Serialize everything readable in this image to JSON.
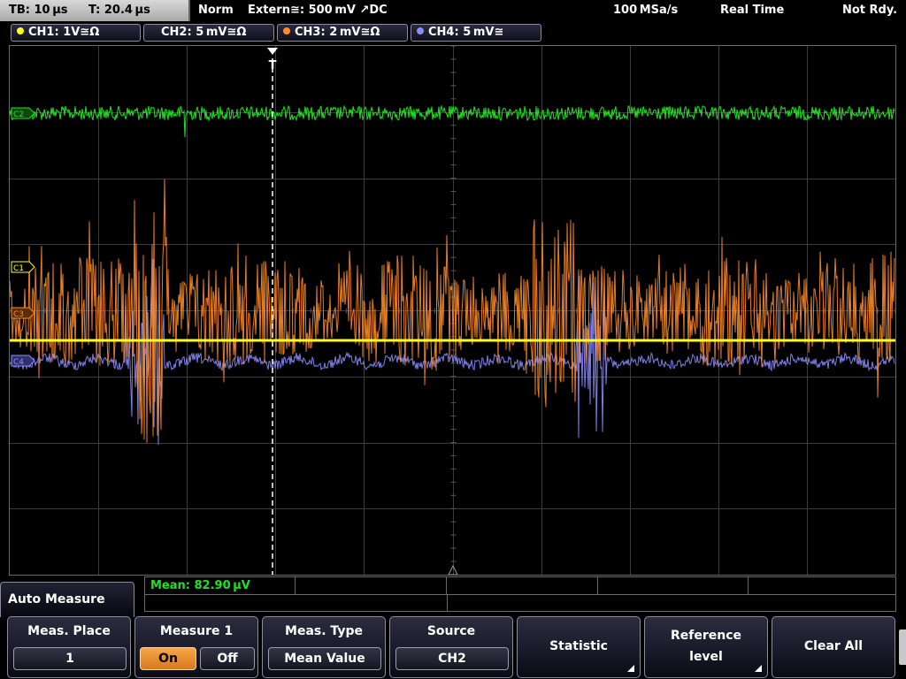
{
  "status_bar": {
    "timebase": "TB: 10 µs",
    "trigger_time": "T: 20.4 µs",
    "mode": "Norm",
    "trigger": "Extern≅: 500 mV ↗DC",
    "sample_rate": "100 MSa/s",
    "acq_mode": "Real Time",
    "state": "Not Rdy."
  },
  "channels": [
    {
      "label": "CH1: 1V≅Ω",
      "color": "#ffff20",
      "active": false
    },
    {
      "label": "CH2: 5 mV≅Ω",
      "color": "#22e022",
      "active": true
    },
    {
      "label": "CH3: 2 mV≅Ω",
      "color": "#ff8c28",
      "active": false
    },
    {
      "label": "CH4: 5 mV≅",
      "color": "#8c8cff",
      "active": false
    }
  ],
  "markers": {
    "ch1": "C1",
    "ch2": "C2",
    "ch3": "C3",
    "ch4": "C4",
    "trigger": "T"
  },
  "measurement": {
    "result": "Mean: 82.90 µV",
    "result_color": "#22e022"
  },
  "menu": {
    "title": "Auto Measure"
  },
  "softkeys": {
    "meas_place": {
      "label": "Meas. Place",
      "value": "1"
    },
    "measure1": {
      "label": "Measure 1",
      "on": "On",
      "off": "Off",
      "selected": "On"
    },
    "meas_type": {
      "label": "Meas. Type",
      "value": "Mean Value"
    },
    "source": {
      "label": "Source",
      "value": "CH2"
    },
    "statistic": {
      "label": "Statistic"
    },
    "reference": {
      "line1": "Reference",
      "line2": "level"
    },
    "clear_all": {
      "label": "Clear All"
    }
  },
  "colors": {
    "ch1": "#ffff20",
    "ch2": "#22e022",
    "ch3": "#ff8c28",
    "ch4": "#8c8cff",
    "selected_option": "#f09a3a",
    "grid": "#3c3c3c"
  },
  "icons": {
    "trigger_marker": "trigger-position-marker-icon",
    "submenu": "submenu-triangle-icon",
    "channel": "channel-dot-icon"
  }
}
